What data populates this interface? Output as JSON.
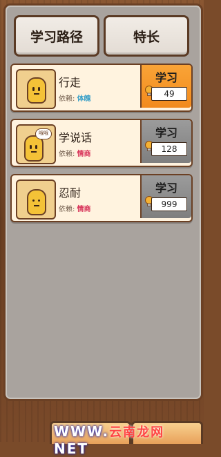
{
  "tabs": [
    {
      "label": "学习路径"
    },
    {
      "label": "特长"
    }
  ],
  "skills": [
    {
      "name": "行走",
      "dep_label": "依赖:",
      "dep_value": "体魄",
      "dep_color": "#3aa0c8",
      "learn_label": "学习",
      "cost": "49",
      "state": "active"
    },
    {
      "name": "学说话",
      "dep_label": "依赖:",
      "dep_value": "情商",
      "dep_color": "#d8345a",
      "learn_label": "学习",
      "cost": "128",
      "state": "inactive",
      "bubble": "哦哦"
    },
    {
      "name": "忍耐",
      "dep_label": "依赖:",
      "dep_value": "情商",
      "dep_color": "#d8345a",
      "learn_label": "学习",
      "cost": "999",
      "state": "inactive"
    }
  ],
  "watermark": {
    "text": "WWW.",
    "red_text": "云南龙网",
    "tail": "NET"
  },
  "colors": {
    "active_learn": "#f28a1d",
    "inactive_learn": "#8a8a8a",
    "frame": "#a9a39e"
  },
  "icons": [
    "lightbulb-icon",
    "character-avatar"
  ]
}
